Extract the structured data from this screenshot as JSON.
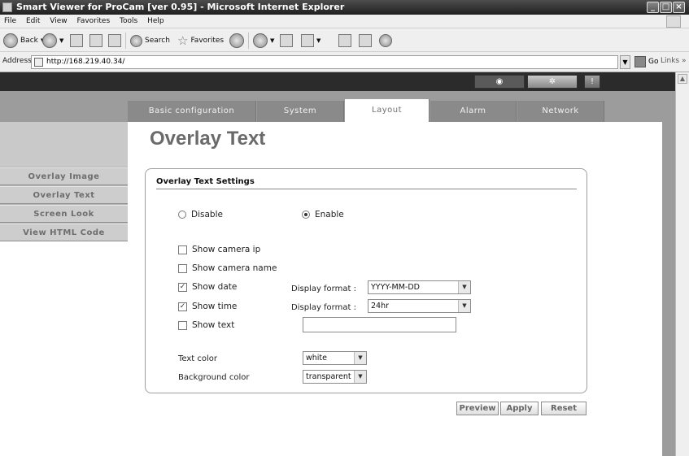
{
  "window": {
    "title": "Smart Viewer for ProCam [ver 0.95] - Microsoft Internet Explorer"
  },
  "menu": [
    "File",
    "Edit",
    "View",
    "Favorites",
    "Tools",
    "Help"
  ],
  "toolbar": {
    "back": "Back",
    "search": "Search",
    "favorites": "Favorites"
  },
  "address": {
    "label": "Address",
    "url": "http://168.219.40.34/",
    "go": "Go",
    "links": "Links"
  },
  "tabs": [
    "Basic configuration",
    "System",
    "Layout",
    "Alarm",
    "Network"
  ],
  "active_tab": "Layout",
  "sidebar": [
    "Overlay Image",
    "Overlay Text",
    "Screen Look",
    "View HTML Code"
  ],
  "page": {
    "title": "Overlay Text",
    "section_title": "Overlay Text Settings"
  },
  "form": {
    "disable_label": "Disable",
    "enable_label": "Enable",
    "enabled": true,
    "show_camera_ip": "Show camera ip",
    "show_camera_name": "Show camera name",
    "show_date": "Show date",
    "show_time": "Show time",
    "show_text": "Show text",
    "display_format_label": "Display format :",
    "date_format": "YYYY-MM-DD",
    "time_format": "24hr",
    "text_color_label": "Text color",
    "text_color": "white",
    "bg_color_label": "Background color",
    "bg_color": "transparent",
    "checked": {
      "camera_ip": false,
      "camera_name": false,
      "date": true,
      "time": true,
      "text": false
    }
  },
  "buttons": {
    "preview": "Preview",
    "apply": "Apply",
    "reset": "Reset"
  }
}
